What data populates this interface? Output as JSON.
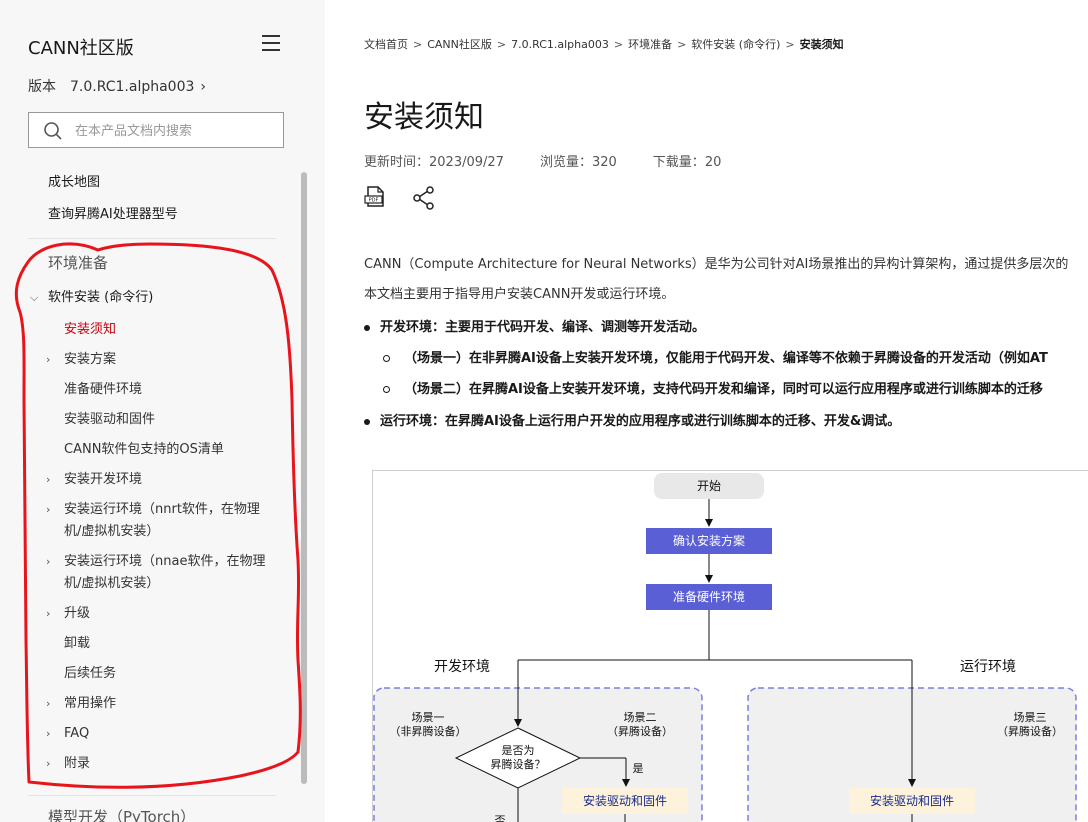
{
  "sidebar": {
    "product_title": "CANN社区版",
    "version_label": "版本",
    "version_value": "7.0.RC1.alpha003",
    "search_placeholder": "在本产品文档内搜索",
    "top_items": [
      "成长地图",
      "查询昇腾AI处理器型号"
    ],
    "section": "环境准备",
    "group": "软件安装 (命令行)",
    "items": [
      {
        "label": "安装须知",
        "active": true,
        "expandable": false
      },
      {
        "label": "安装方案",
        "expandable": true
      },
      {
        "label": "准备硬件环境",
        "expandable": false
      },
      {
        "label": "安装驱动和固件",
        "expandable": false
      },
      {
        "label": "CANN软件包支持的OS清单",
        "expandable": false
      },
      {
        "label": "安装开发环境",
        "expandable": true
      },
      {
        "label_line1": "安装运行环境（nnrt软件，在物理",
        "label_line2": "机/虚拟机安装）",
        "expandable": true
      },
      {
        "label_line1": "安装运行环境（nnae软件，在物理",
        "label_line2": "机/虚拟机安装）",
        "expandable": true
      },
      {
        "label": "升级",
        "expandable": true
      },
      {
        "label": "卸载",
        "expandable": false
      },
      {
        "label": "后续任务",
        "expandable": false
      },
      {
        "label": "常用操作",
        "expandable": true
      },
      {
        "label": "FAQ",
        "expandable": true
      },
      {
        "label": "附录",
        "expandable": true
      }
    ],
    "next_section": "模型开发（PyTorch）",
    "annotation_color": "#e8141b"
  },
  "breadcrumb": [
    "文档首页",
    "CANN社区版",
    "7.0.RC1.alpha003",
    "环境准备",
    "软件安装 (命令行)",
    "安装须知"
  ],
  "page_title": "安装须知",
  "meta": {
    "updated_label": "更新时间：",
    "updated_value": "2023/09/27",
    "views_label": "浏览量：",
    "views_value": "320",
    "downloads_label": "下载量：",
    "downloads_value": "20"
  },
  "actions": {
    "pdf_icon": "pdf-icon",
    "share_icon": "share-icon"
  },
  "content": {
    "intro": "CANN（Compute Architecture for Neural Networks）是华为公司针对AI场景推出的异构计算架构，通过提供多层次的",
    "purpose": "本文档主要用于指导用户安装CANN开发或运行环境。",
    "dev_env": "开发环境：主要用于代码开发、编译、调测等开发活动。",
    "dev_scenario1": "（场景一）在非昇腾AI设备上安装开发环境，仅能用于代码开发、编译等不依赖于昇腾设备的开发活动（例如AT",
    "dev_scenario2": "（场景二）在昇腾AI设备上安装开发环境，支持代码开发和编译，同时可以运行应用程序或进行训练脚本的迁移",
    "run_env": "运行环境：在昇腾AI设备上运行用户开发的应用程序或进行训练脚本的迁移、开发&调试。"
  },
  "flowchart": {
    "start": "开始",
    "step1": "确认安装方案",
    "step2": "准备硬件环境",
    "dev_label": "开发环境",
    "run_label": "运行环境",
    "scene1_line1": "场景一",
    "scene1_line2": "（非昇腾设备）",
    "scene2_line1": "场景二",
    "scene2_line2": "（昇腾设备）",
    "scene3_line1": "场景三",
    "scene3_line2": "（昇腾设备）",
    "decision_line1": "是否为",
    "decision_line2": "昇腾设备？",
    "yes": "是",
    "no": "否",
    "driver_dev": "安装驱动和固件",
    "driver_run": "安装驱动和固件",
    "step_color": "#5b5fd6",
    "dash_color": "#7b7fe0"
  }
}
